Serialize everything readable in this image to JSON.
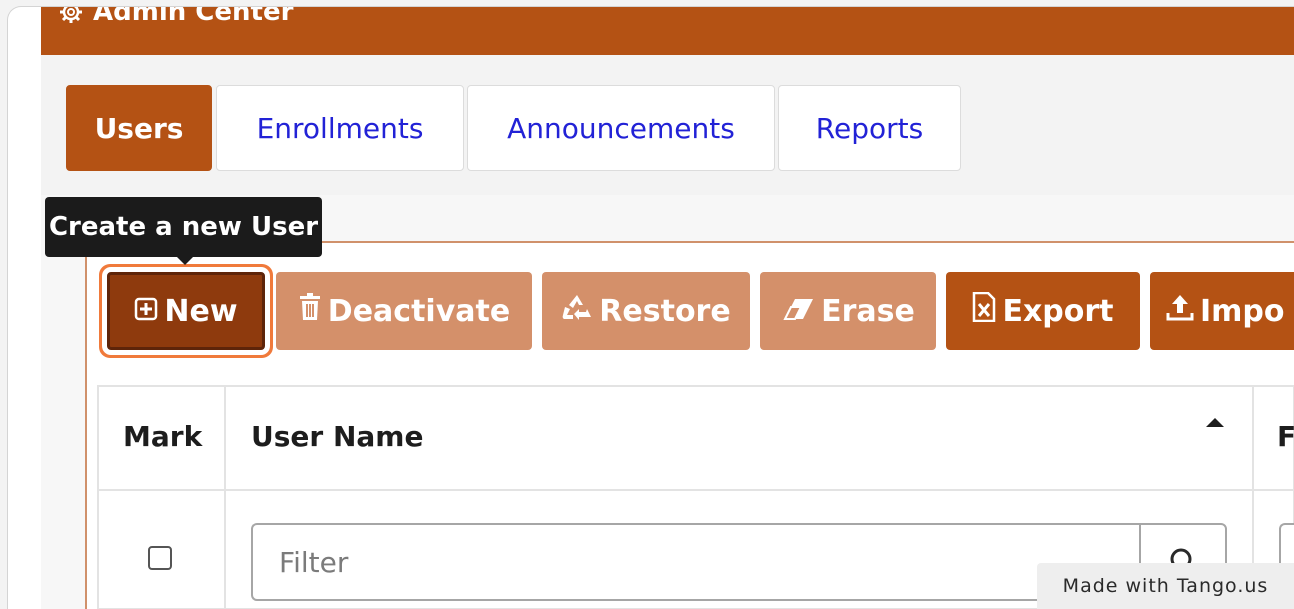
{
  "header": {
    "title": "Admin Center",
    "icon": "gear-icon"
  },
  "tabs": [
    {
      "label": "Users",
      "active": true
    },
    {
      "label": "Enrollments",
      "active": false
    },
    {
      "label": "Announcements",
      "active": false
    },
    {
      "label": "Reports",
      "active": false
    }
  ],
  "tooltip": {
    "text": "Create a new User"
  },
  "toolbar": {
    "new_label": "New",
    "deactivate_label": "Deactivate",
    "restore_label": "Restore",
    "erase_label": "Erase",
    "export_label": "Export",
    "import_label": "Impo"
  },
  "table": {
    "columns": [
      "Mark",
      "User Name",
      "F"
    ],
    "filter_placeholder": "Filter",
    "sort": "ascending"
  },
  "watermark": {
    "text": "Made with Tango.us"
  },
  "colors": {
    "accent": "#b45214",
    "accent_light": "#d4906a",
    "accent_dark": "#8e3a0d",
    "highlight_ring": "#f07a3b",
    "tab_link": "#2222d6"
  }
}
